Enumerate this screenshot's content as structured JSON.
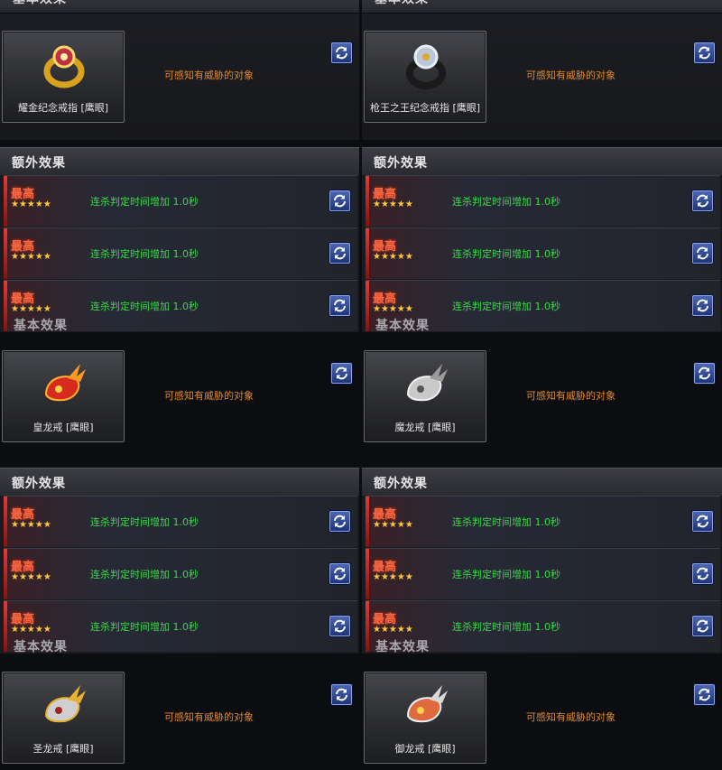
{
  "labels": {
    "basic_effect": "基本效果",
    "extra_effect": "额外效果",
    "grade": "最高",
    "stars": "★★★★★"
  },
  "rings": [
    {
      "name": "耀金纪念戒指 [鹰眼]",
      "effect": "可感知有威胁的对象",
      "color": "#d8a21e"
    },
    {
      "name": "枪王之王纪念戒指 [鹰眼]",
      "effect": "可感知有威胁的对象",
      "color": "#b7c7d8"
    },
    {
      "name": "皇龙戒 [鹰眼]",
      "effect": "可感知有威胁的对象",
      "color": "#d62a1c"
    },
    {
      "name": "魔龙戒 [鹰眼]",
      "effect": "可感知有威胁的对象",
      "color": "#c9c9c9"
    },
    {
      "name": "圣龙戒 [鹰眼]",
      "effect": "可感知有威胁的对象",
      "color": "#e8b030"
    },
    {
      "name": "御龙戒 [鹰眼]",
      "effect": "可感知有威胁的对象",
      "color": "#e06a40"
    }
  ],
  "extra_effects": [
    [
      "连杀判定时间增加 1.0秒",
      "连杀判定时间增加 1.0秒",
      "连杀判定时间增加 1.0秒"
    ],
    [
      "连杀判定时间增加 1.0秒",
      "连杀判定时间增加 1.0秒",
      "连杀判定时间增加 1.0秒"
    ],
    [
      "连杀判定时间增加 1.0秒",
      "连杀判定时间增加 1.0秒",
      "连杀判定时间增加 1.0秒"
    ],
    [
      "连杀判定时间增加 1.0秒",
      "连杀判定时间增加 1.0秒",
      "连杀判定时间增加 1.0秒"
    ]
  ]
}
